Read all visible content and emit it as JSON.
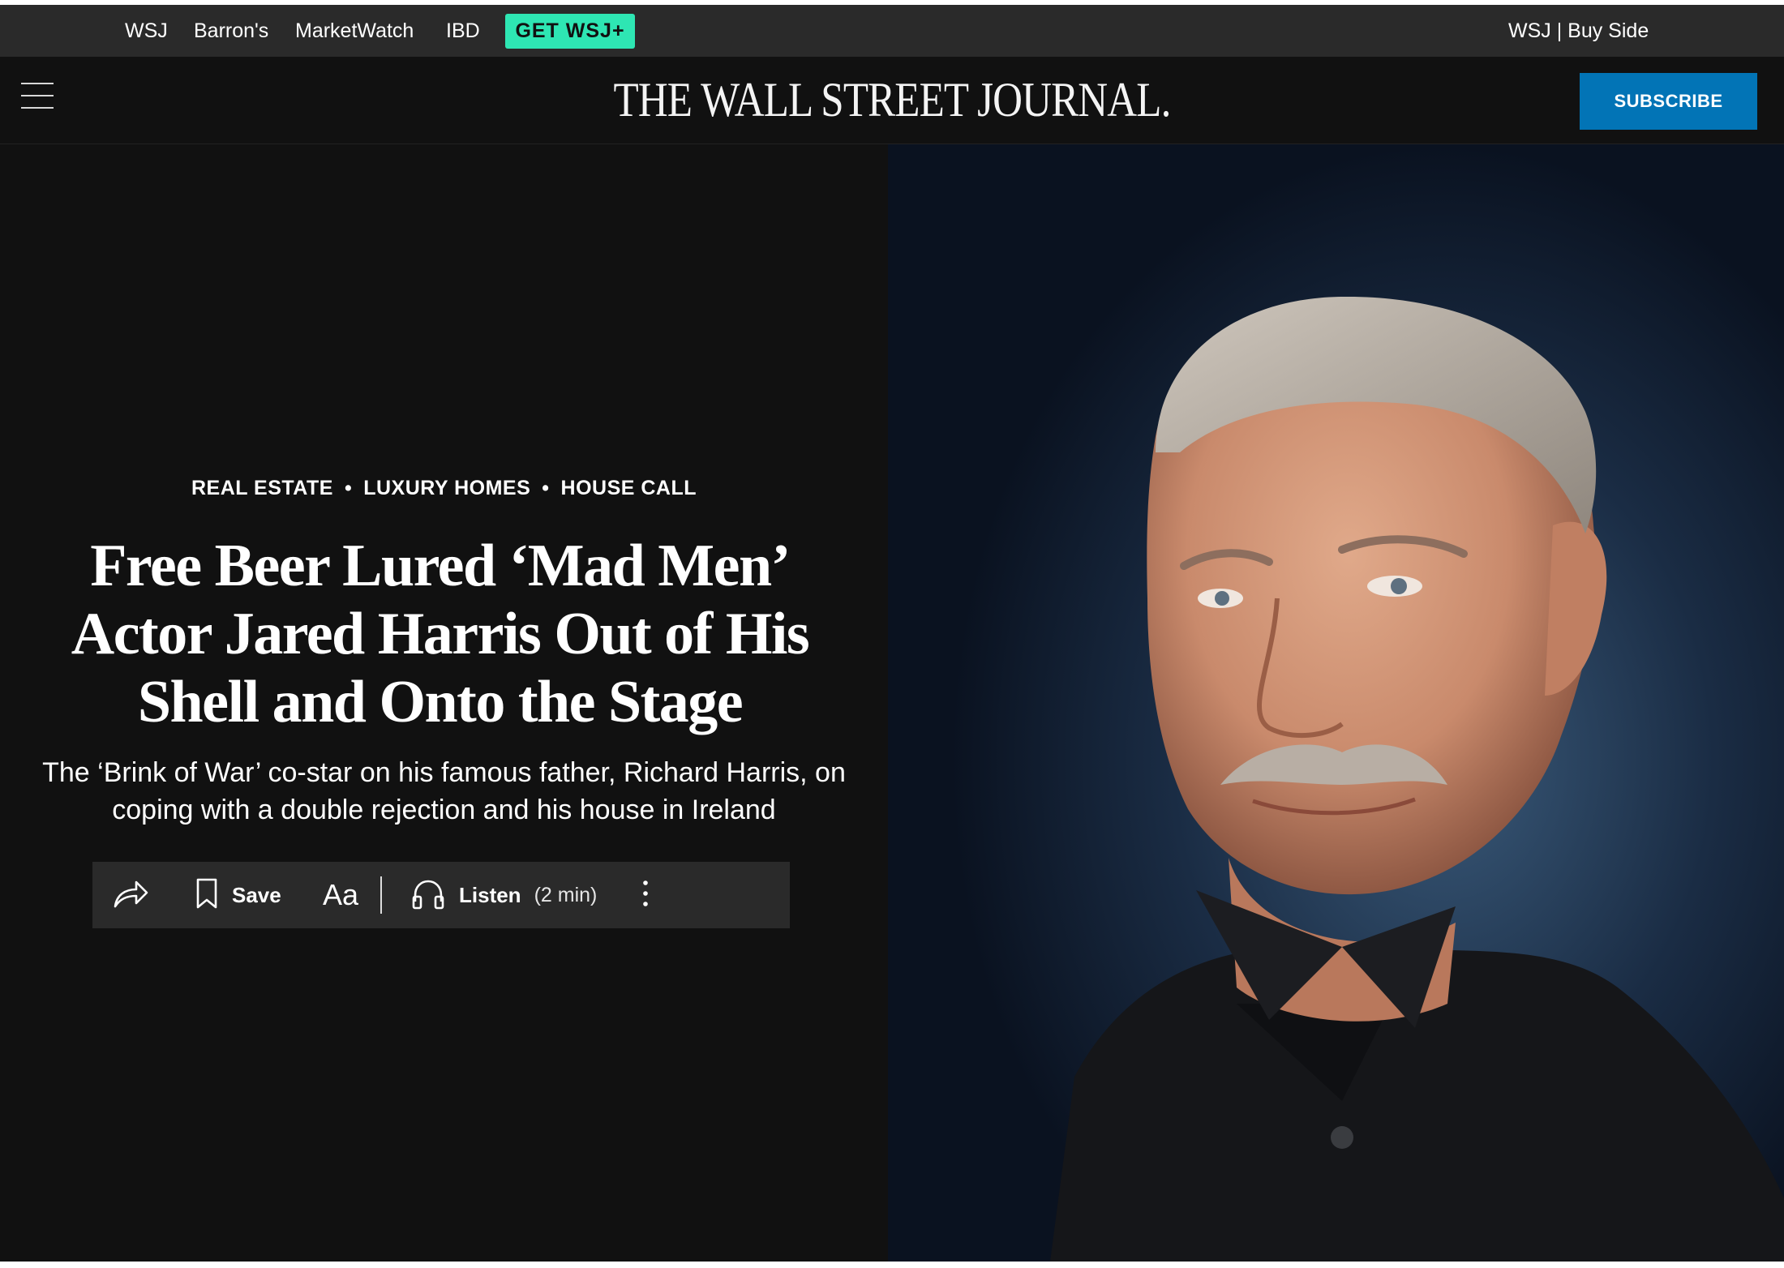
{
  "brand_nav": {
    "links": [
      "WSJ",
      "Barron's",
      "MarketWatch",
      "IBD"
    ],
    "cta": "GET WSJ+",
    "right_link": "WSJ | Buy Side"
  },
  "masthead": {
    "logo": "THE WALL STREET JOURNAL.",
    "subscribe": "SUBSCRIBE",
    "menu_icon": "hamburger-menu-icon"
  },
  "article": {
    "breadcrumbs": [
      "REAL ESTATE",
      "LUXURY HOMES",
      "HOUSE CALL"
    ],
    "headline": "Free Beer Lured ‘Mad Men’ Actor Jared Harris Out of His Shell and Onto the Stage",
    "dek": "The ‘Brink of War’ co-star on his famous father, Richard Harris, on coping with a double rejection and his house in Ireland"
  },
  "toolbar": {
    "share_icon": "share-icon",
    "save_icon": "bookmark-icon",
    "save_label": "Save",
    "text_size_label": "Aa",
    "listen_icon": "headphones-icon",
    "listen_label": "Listen",
    "listen_duration": "(2 min)",
    "more_icon": "more-vertical-icon"
  },
  "colors": {
    "brand_bar": "#2a2a2a",
    "masthead_bg": "#111111",
    "cta_green": "#2ee6b3",
    "subscribe_blue": "#0274b6",
    "toolbar_bg": "#2a2a2a"
  }
}
